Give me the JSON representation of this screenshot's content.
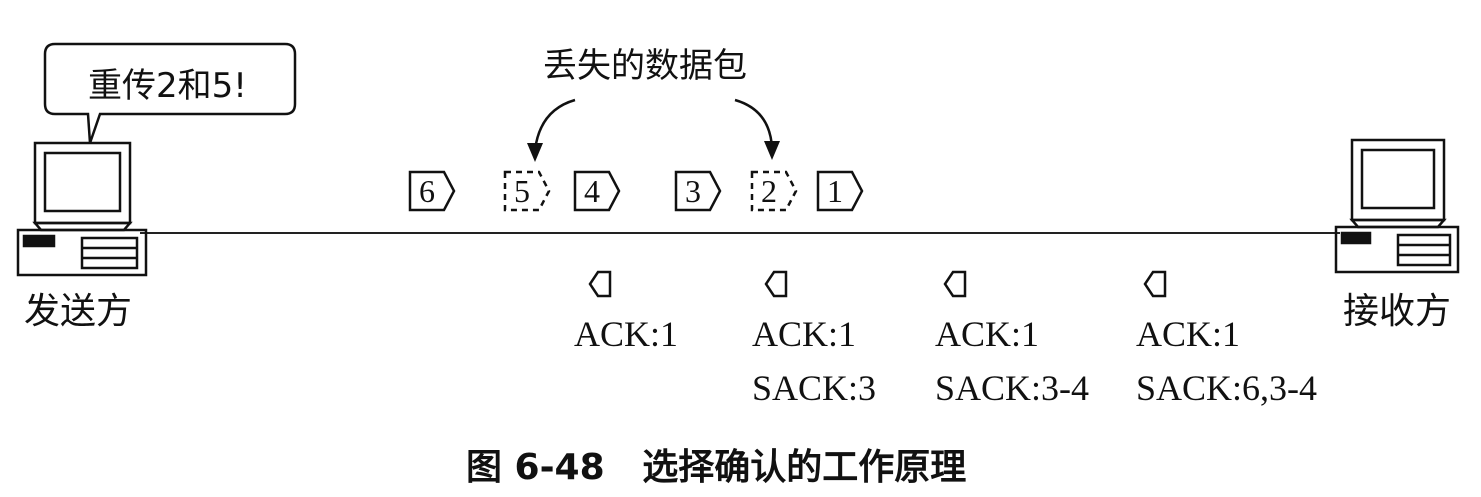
{
  "diagram": {
    "sender_label": "发送方",
    "receiver_label": "接收方",
    "speech_bubble": "重传2和5!",
    "lost_label": "丢失的数据包",
    "caption": "图 6-48   选择确认的工作原理"
  },
  "packets": [
    {
      "label": "6",
      "lost": false
    },
    {
      "label": "5",
      "lost": true
    },
    {
      "label": "4",
      "lost": false
    },
    {
      "label": "3",
      "lost": false
    },
    {
      "label": "2",
      "lost": true
    },
    {
      "label": "1",
      "lost": false
    }
  ],
  "acks": [
    {
      "ack": "ACK:1",
      "sack": ""
    },
    {
      "ack": "ACK:1",
      "sack": "SACK:3"
    },
    {
      "ack": "ACK:1",
      "sack": "SACK:3-4"
    },
    {
      "ack": "ACK:1",
      "sack": "SACK:6,3-4"
    }
  ]
}
